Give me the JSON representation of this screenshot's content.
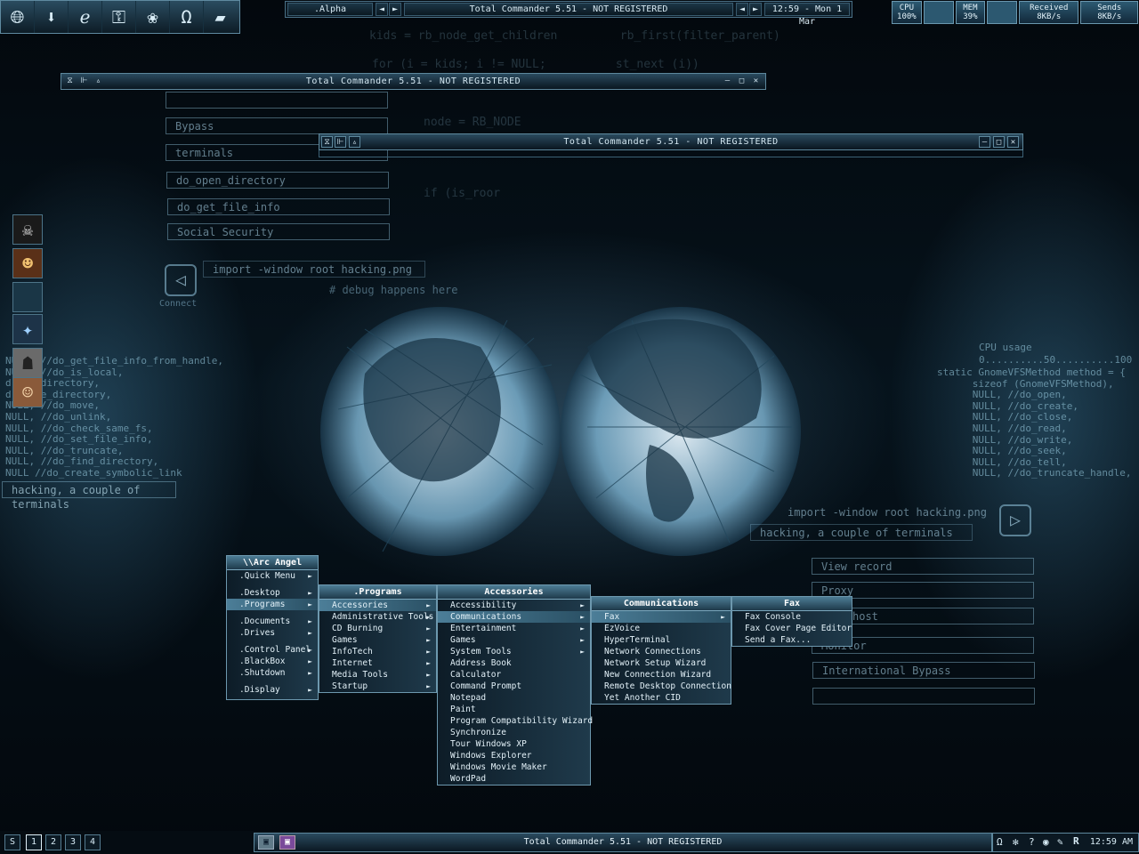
{
  "top": {
    "workspace": ".Alpha",
    "title": "Total Commander 5.51 - NOT REGISTERED",
    "clock": "12:59 - Mon 1 Mar",
    "left_arrow": "◄",
    "right_arrow": "►",
    "icons": [
      "globe-icon",
      "download-icon",
      "internet-explorer-icon",
      "keys-icon",
      "lotus-icon",
      "headphones-icon",
      "folder-icon"
    ]
  },
  "monitors": {
    "cpu_label": "CPU",
    "cpu_value": "100%",
    "mem_label": "MEM",
    "mem_value": "39%",
    "recv_label": "Received",
    "recv_value": "8KB/s",
    "send_label": "Sends",
    "send_value": "8KB/s"
  },
  "windows": [
    {
      "title": "Total Commander 5.51 - NOT REGISTERED"
    },
    {
      "title": "Total Commander 5.51 - NOT REGISTERED"
    }
  ],
  "wallpaper": {
    "left_boxes": [
      "Bypass",
      "terminals",
      "do_open_directory",
      "do_get_file_info",
      "Social Security"
    ],
    "import_text": "import -window root hacking.png",
    "debug_text": "# debug happens here",
    "connect": "Connect",
    "left_code": "NULL, //do_get_file_info_from_handle,\nNULL, //do_is_local,\nd    _directory,\nd    ve_directory,\nNULL, //do_move,\nNULL, //do_unlink,\nNULL, //do_check_same_fs,\nNULL, //do_set_file_info,\nNULL, //do_truncate,\nNULL, //do_find_directory,\nNULL //do_create_symbolic_link",
    "left_caption": "hacking, a couple of terminals",
    "cpu_usage": "CPU usage",
    "cpu_scale": "0..........50..........100",
    "right_code": "static GnomeVFSMethod method = {\n      sizeof (GnomeVFSMethod),\n      NULL, //do_open,\n      NULL, //do_create,\n      NULL, //do_close,\n      NULL, //do_read,\n      NULL, //do_write,\n      NULL, //do_seek,\n      NULL, //do_tell,\n      NULL, //do_truncate_handle,",
    "right_import": "import -window root hacking.png",
    "right_caption": "hacking, a couple of terminals",
    "right_boxes": [
      "View record",
      "Proxy",
      "host",
      "Monitor",
      "International Bypass",
      ""
    ],
    "top_code_1": "kids = rb_node_get_children         rb_first(filter_parent)",
    "top_code_2": "for (i = kids; i != NULL;          st_next (i))",
    "top_code_3": "node = RB_NODE",
    "top_code_4": "if (is_roor"
  },
  "menus": {
    "root": {
      "title": "\\\\Arc Angel",
      "items": [
        {
          "label": ".Quick Menu",
          "arrow": true
        },
        {
          "label": ".Desktop",
          "arrow": true
        },
        {
          "label": ".Programs",
          "arrow": true
        },
        {
          "label": ".Documents",
          "arrow": true
        },
        {
          "label": ".Drives",
          "arrow": true
        },
        {
          "label": ".Control Panel",
          "arrow": true
        },
        {
          "label": ".BlackBox",
          "arrow": true
        },
        {
          "label": ".Shutdown",
          "arrow": true
        },
        {
          "label": ".Display",
          "arrow": true
        }
      ]
    },
    "programs": {
      "title": ".Programs",
      "items": [
        "Accessories",
        "Administrative Tools",
        "CD Burning",
        "Games",
        "InfoTech",
        "Internet",
        "Media Tools",
        "Startup"
      ]
    },
    "accessories": {
      "title": "Accessories",
      "items": [
        "Accessibility",
        "Communications",
        "Entertainment",
        "Games",
        "System Tools",
        "Address Book",
        "Calculator",
        "Command Prompt",
        "Notepad",
        "Paint",
        "Program Compatibility Wizard",
        "Synchronize",
        "Tour Windows XP",
        "Windows Explorer",
        "Windows Movie Maker",
        "WordPad"
      ]
    },
    "communications": {
      "title": "Communications",
      "items": [
        "Fax",
        "EzVoice",
        "HyperTerminal",
        "Network Connections",
        "Network Setup Wizard",
        "New Connection Wizard",
        "Remote Desktop Connection",
        "Yet Another CID"
      ]
    },
    "fax": {
      "title": "Fax",
      "items": [
        "Fax Console",
        "Fax Cover Page Editor",
        "Send a Fax..."
      ]
    }
  },
  "taskbar": {
    "workspaces": [
      "S",
      "1",
      "2",
      "3",
      "4"
    ],
    "task_title": "Total Commander 5.51 - NOT REGISTERED",
    "clock": "12:59 AM"
  }
}
